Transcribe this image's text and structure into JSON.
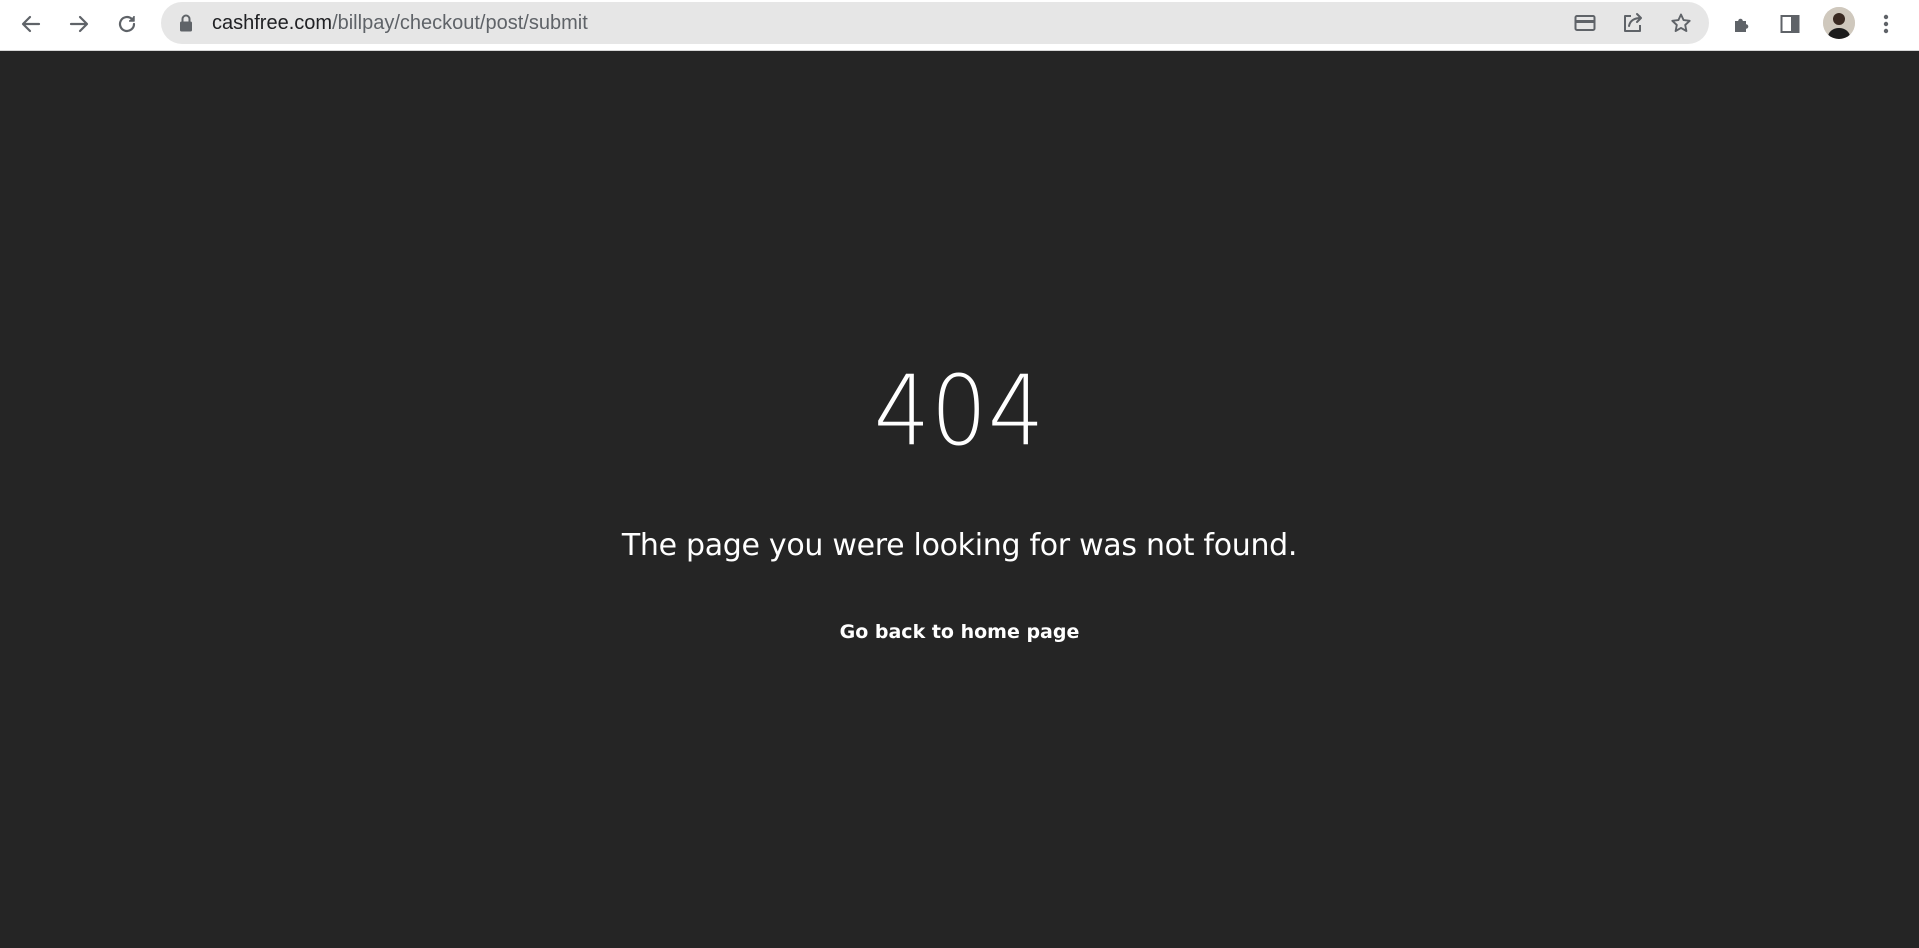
{
  "browser": {
    "url_host": "cashfree.com",
    "url_path": "/billpay/checkout/post/submit",
    "icons": {
      "back": "back-arrow-icon",
      "forward": "forward-arrow-icon",
      "reload": "reload-icon",
      "lock": "lock-icon",
      "payment": "card-icon",
      "share": "share-icon",
      "bookmark": "star-icon",
      "extensions": "puzzle-icon",
      "side_panel": "side-panel-icon",
      "menu": "kebab-menu-icon"
    }
  },
  "page": {
    "error_code": "404",
    "message": "The page you were looking for was not found.",
    "home_link": "Go back to home page"
  },
  "colors": {
    "page_background": "#252525",
    "text": "#ffffff",
    "toolbar": "#ffffff",
    "omnibox": "#e6e6e6"
  }
}
